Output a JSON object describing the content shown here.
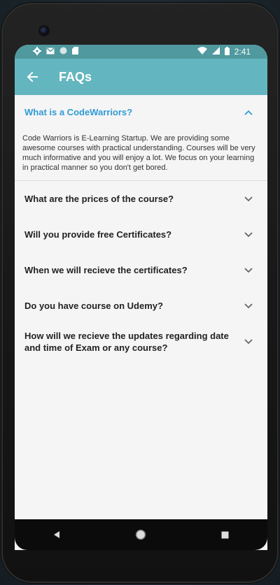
{
  "status_bar": {
    "time": "2:41",
    "left_icons": [
      "gear-icon",
      "gmail-icon",
      "circle-icon",
      "sd-card-icon"
    ],
    "right_icons": [
      "wifi-icon",
      "signal-icon",
      "battery-icon"
    ]
  },
  "app_bar": {
    "title": "FAQs",
    "back_icon": "arrow-left-icon"
  },
  "faqs": [
    {
      "question": "What is a CodeWarriors?",
      "answer": "Code Warriors is E-Learning Startup. We are providing some awesome courses with practical understanding. Courses will be very much informative and you will enjoy a lot. We focus on your learning in practical manner so you don't get bored.",
      "expanded": true
    },
    {
      "question": "What are the prices of the course?",
      "expanded": false
    },
    {
      "question": "Will you provide free Certificates?",
      "expanded": false
    },
    {
      "question": "When we will recieve the certificates?",
      "expanded": false
    },
    {
      "question": "Do you have course on Udemy?",
      "expanded": false
    },
    {
      "question": "How will we recieve the updates regarding date and time of Exam or any course?",
      "expanded": false
    }
  ],
  "colors": {
    "status_bar": "#4f999f",
    "app_bar": "#63b6bf",
    "accent_question": "#2f9bd6",
    "background": "#f5f5f5"
  },
  "nav_bar": {
    "buttons": [
      "back-triangle-icon",
      "home-circle-icon",
      "recents-square-icon"
    ]
  }
}
